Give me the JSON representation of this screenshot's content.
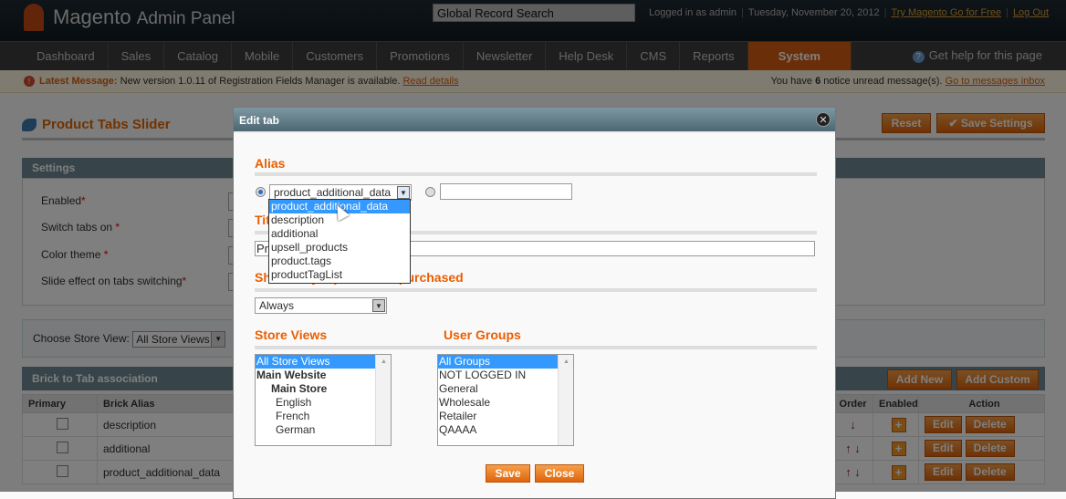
{
  "header": {
    "logo": "Magento",
    "logo_suffix": "Admin Panel",
    "search_placeholder": "Global Record Search",
    "logged_in": "Logged in as admin",
    "date": "Tuesday, November 20, 2012",
    "try_link": "Try Magento Go for Free",
    "logout": "Log Out"
  },
  "nav": {
    "items": [
      "Dashboard",
      "Sales",
      "Catalog",
      "Mobile",
      "Customers",
      "Promotions",
      "Newsletter",
      "Help Desk",
      "CMS",
      "Reports",
      "System"
    ],
    "active": "System",
    "help": "Get help for this page"
  },
  "message": {
    "label": "Latest Message:",
    "text": "New version 1.0.11 of Registration Fields Manager is available.",
    "link": "Read details",
    "right_pre": "You have",
    "count": "6",
    "right_post": "notice unread message(s).",
    "inbox_link": "Go to messages inbox"
  },
  "page": {
    "title": "Product Tabs Slider",
    "reset": "Reset",
    "save_settings": "Save Settings"
  },
  "settings": {
    "title": "Settings",
    "fields": [
      "Enabled",
      "Switch tabs on",
      "Color theme",
      "Slide effect on tabs switching"
    ],
    "required_mark": "*"
  },
  "store": {
    "label": "Choose Store View:",
    "value": "All Store Views"
  },
  "brick": {
    "title": "Brick to Tab association",
    "add_new": "Add New",
    "add_custom": "Add Custom",
    "columns": [
      "Primary",
      "Brick Alias",
      "Order",
      "Enabled",
      "Action"
    ],
    "rows": [
      {
        "alias": "description",
        "order": "↓"
      },
      {
        "alias": "additional",
        "order": "↑ ↓"
      },
      {
        "alias": "product_additional_data",
        "order": "↑ ↓"
      }
    ],
    "edit": "Edit",
    "delete": "Delete"
  },
  "dialog": {
    "title": "Edit tab",
    "alias_label": "Alias",
    "alias_value": "product_additional_data",
    "alias_custom": "",
    "alias_options": [
      "product_additional_data",
      "description",
      "additional",
      "upsell_products",
      "product.tags",
      "productTagList"
    ],
    "title_label": "Title",
    "title_value": "Pr",
    "show_label": "Show only if product is purchased",
    "show_value": "Always",
    "store_views_label": "Store Views",
    "store_views": [
      "All Store Views",
      "Main Website",
      "Main Store",
      "English",
      "French",
      "German"
    ],
    "user_groups_label": "User Groups",
    "user_groups": [
      "All Groups",
      "NOT LOGGED IN",
      "General",
      "Wholesale",
      "Retailer",
      "QAAAA"
    ],
    "save": "Save",
    "close": "Close"
  },
  "colors": {
    "accent": "#eb5e00",
    "header": "#1d2a32",
    "selection": "#3399ff"
  }
}
